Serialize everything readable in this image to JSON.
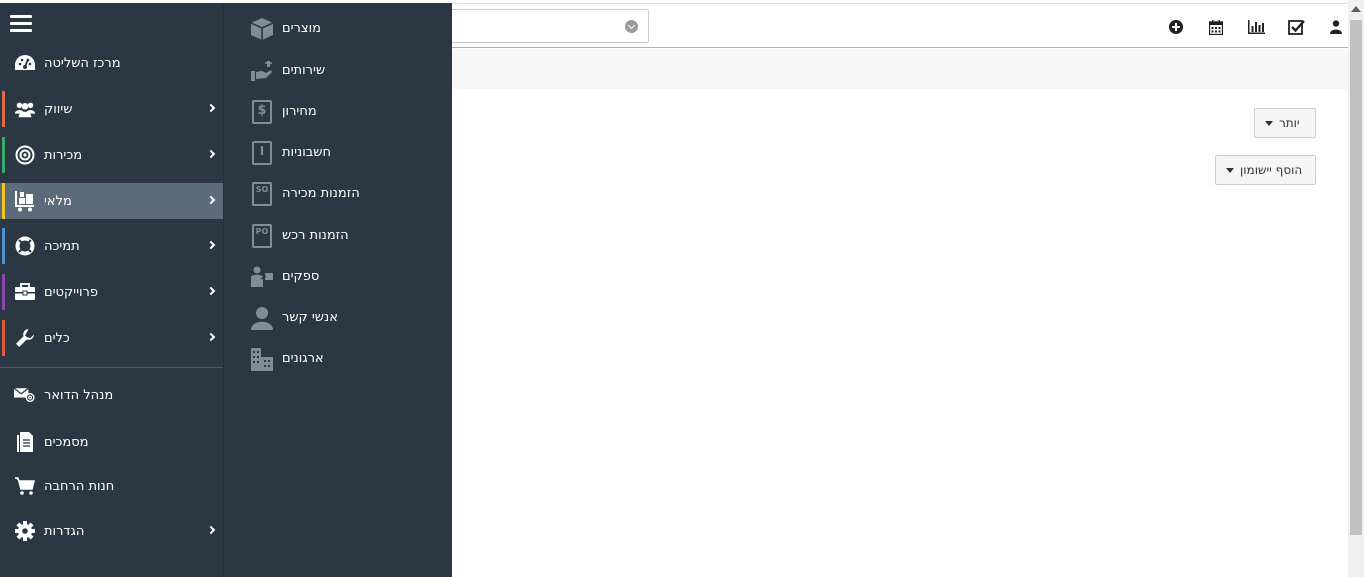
{
  "sidebar": {
    "items": [
      {
        "label": "מרכז השליטה",
        "icon": "dashboard-icon",
        "color": "",
        "arrow": false
      },
      {
        "label": "שיווק",
        "icon": "users-icon",
        "color": "#e06c43",
        "arrow": true
      },
      {
        "label": "מכירות",
        "icon": "target-icon",
        "color": "#3aaa6a",
        "arrow": true
      },
      {
        "label": "מלאי",
        "icon": "inventory-cart-icon",
        "color": "#f0c419",
        "arrow": true
      },
      {
        "label": "תמיכה",
        "icon": "lifebuoy-icon",
        "color": "#4c93d6",
        "arrow": true
      },
      {
        "label": "פרוייקטים",
        "icon": "briefcase-icon",
        "color": "#8e44ad",
        "arrow": true
      },
      {
        "label": "כלים",
        "icon": "wrench-icon",
        "color": "#e05a3a",
        "arrow": true
      },
      {
        "label": "מנהל הדואר",
        "icon": "mail-at-icon",
        "color": "",
        "arrow": false
      },
      {
        "label": "מסמכים",
        "icon": "documents-icon",
        "color": "",
        "arrow": false
      },
      {
        "label": "חנות הרחבה",
        "icon": "cart-icon",
        "color": "",
        "arrow": false
      },
      {
        "label": "הגדרות",
        "icon": "gear-icon",
        "color": "",
        "arrow": true
      }
    ]
  },
  "submenu": {
    "items": [
      {
        "label": "מוצרים",
        "icon": "box-icon"
      },
      {
        "label": "שירותים",
        "icon": "hand-service-icon"
      },
      {
        "label": "מחירון",
        "icon": "price-list-icon",
        "glyph": "$"
      },
      {
        "label": "חשבוניות",
        "icon": "invoice-icon",
        "glyph": "I"
      },
      {
        "label": "הזמנות מכירה",
        "icon": "sales-order-icon",
        "glyph": "SO"
      },
      {
        "label": "הזמנות רכש",
        "icon": "purchase-order-icon",
        "glyph": "PO"
      },
      {
        "label": "ספקים",
        "icon": "vendor-icon"
      },
      {
        "label": "אנשי קשר",
        "icon": "contact-icon"
      },
      {
        "label": "ארגונים",
        "icon": "organization-icon"
      }
    ]
  },
  "header": {
    "icons": [
      "add-icon",
      "calendar-icon",
      "chart-icon",
      "checkbox-icon",
      "user-icon"
    ]
  },
  "actions": {
    "more_label": "יותר",
    "add_record_label": "הוסף יישומון"
  },
  "colors": {
    "sidebar_bg": "#2b3743",
    "active_bg": "#5c6b7a",
    "header_border": "#e8a26a"
  }
}
